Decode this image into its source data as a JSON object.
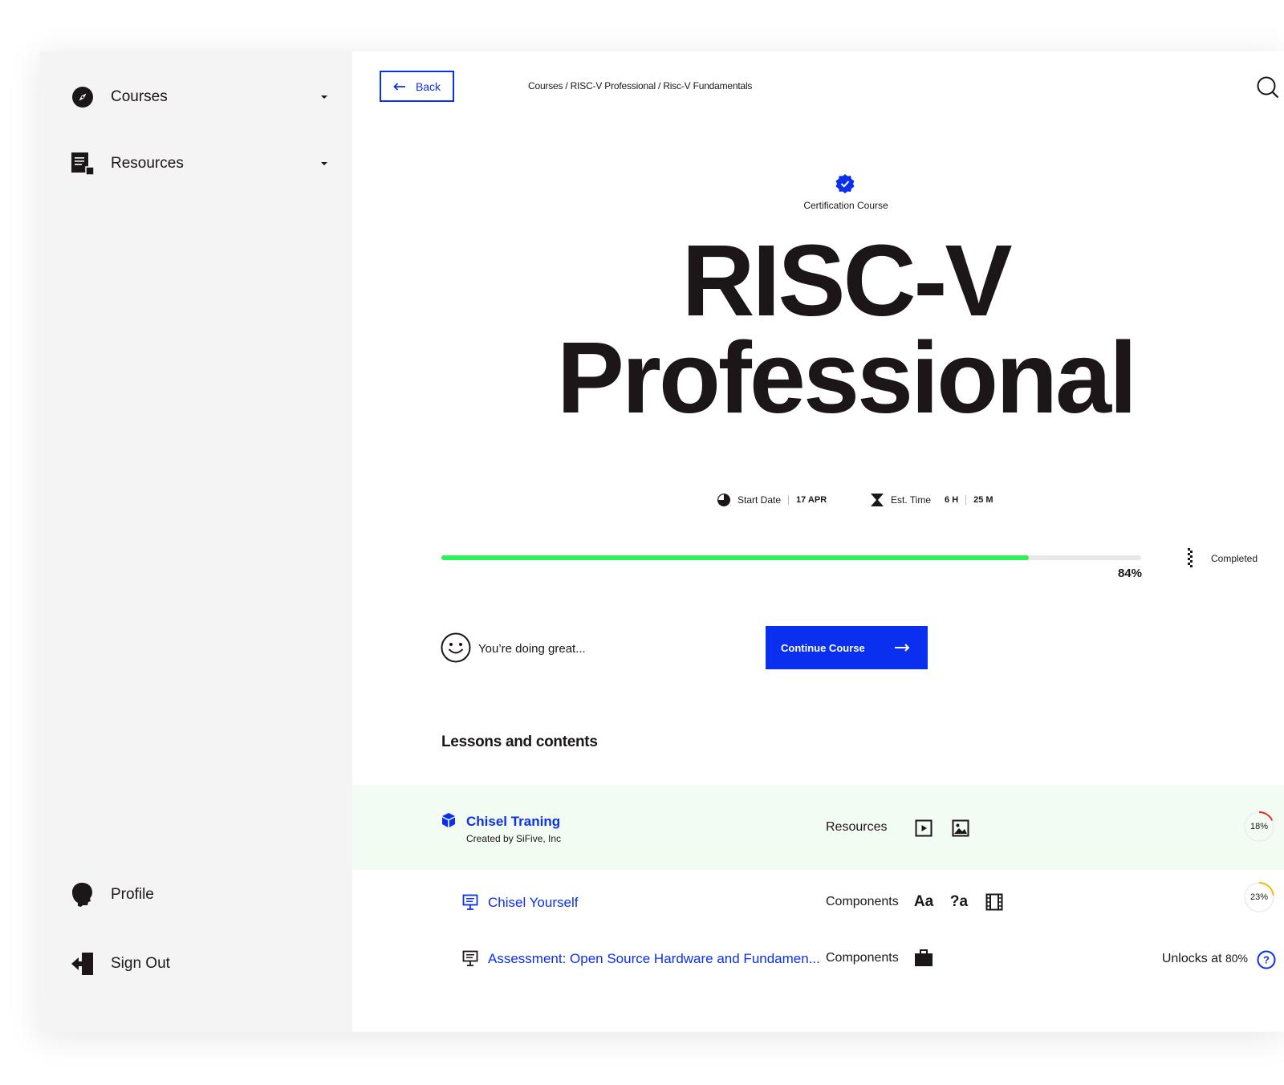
{
  "sidebar": {
    "items": [
      {
        "label": "Courses",
        "icon": "compass-icon"
      },
      {
        "label": "Resources",
        "icon": "document-icon"
      }
    ],
    "bottom": [
      {
        "label": "Profile",
        "icon": "head-icon"
      },
      {
        "label": "Sign Out",
        "icon": "exit-door-icon"
      }
    ]
  },
  "header": {
    "back_label": "Back",
    "breadcrumb": "Courses / RISC-V Professional / Risc-V Fundamentals"
  },
  "hero": {
    "badge_label": "Certification Course",
    "title_line1": "RISC-V",
    "title_line2": "Professional"
  },
  "meta": {
    "start_label": "Start Date",
    "start_value": "17 APR",
    "est_label": "Est. Time",
    "est_hours": "6 H",
    "est_minutes": "25 M"
  },
  "progress": {
    "value": 0.84,
    "label": "84%",
    "completed_label": "Completed",
    "color": "#2ef05a"
  },
  "encouragement": "You’re doing great...",
  "continue_label": "Continue Course",
  "section_title": "Lessons and contents",
  "lessons": [
    {
      "title": "Chisel Traning",
      "subtitle": "Created by SiFive, Inc",
      "kind": "Resources",
      "progress_label": "18%",
      "progress": 0.18,
      "ring_color": "#f0242a"
    },
    {
      "title": "Chisel Yourself",
      "kind": "Components",
      "tools": [
        "Aa",
        "?a"
      ],
      "progress_label": "23%",
      "progress": 0.23,
      "ring_color": "#f5b70a"
    },
    {
      "title": "Assessment: Open Source Hardware and Fundamen...",
      "kind": "Components",
      "unlock_text": "Unlocks at",
      "unlock_pct": "80%"
    }
  ],
  "colors": {
    "accent": "#0b2fef",
    "text": "#1c1618",
    "sidebar_bg": "#f4f4f4",
    "highlight_row": "#f3fcf3"
  }
}
